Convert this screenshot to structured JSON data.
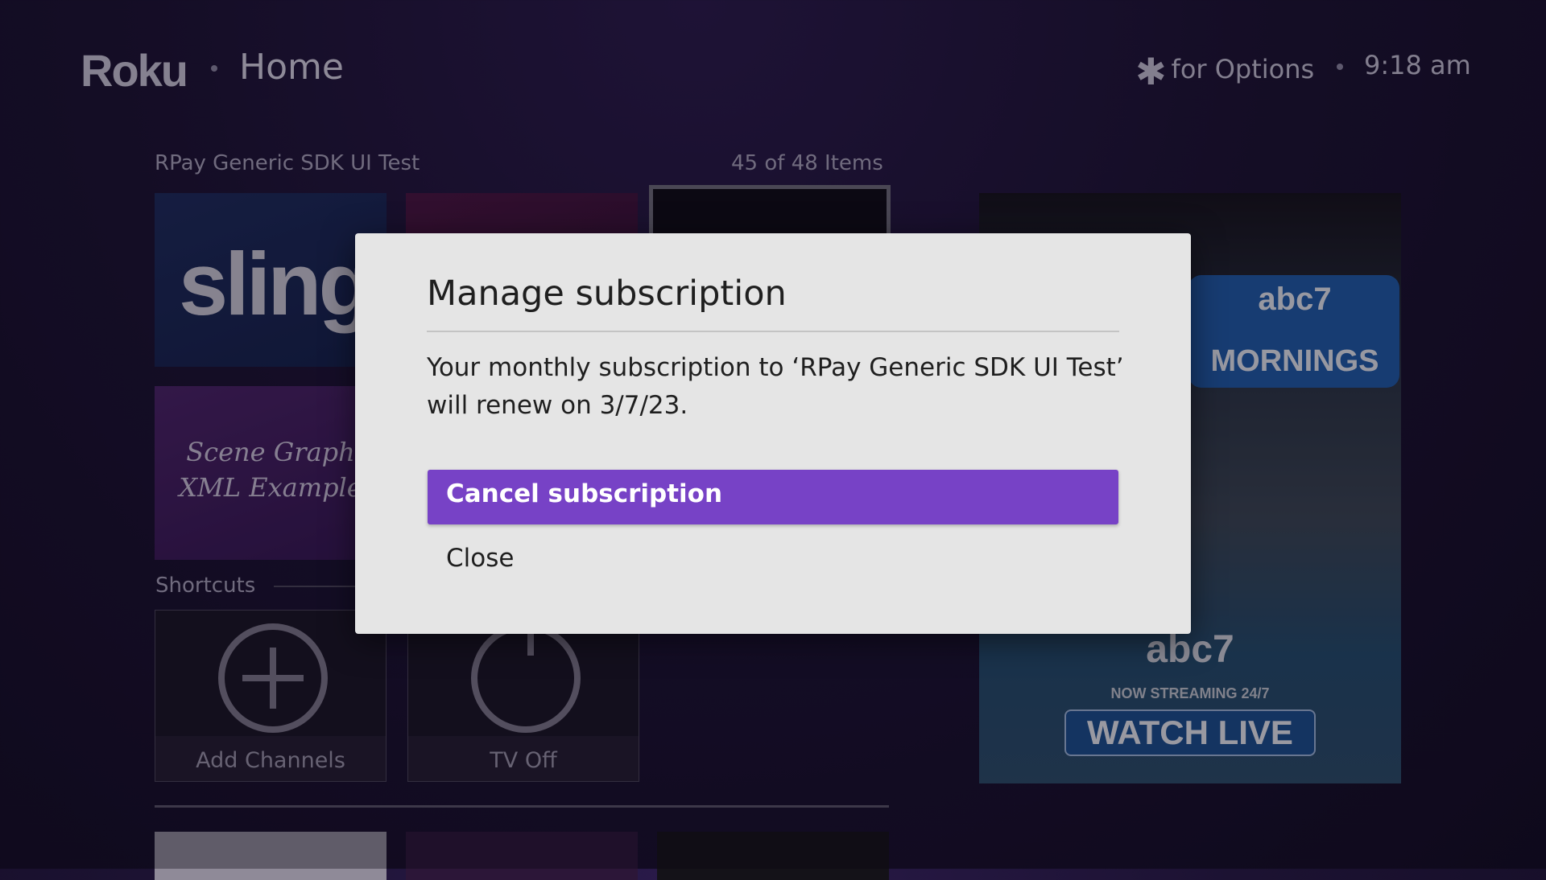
{
  "header": {
    "logo": "Roku",
    "title": "Home",
    "options_star": "✱",
    "options_text": "for Options",
    "time": "9:18 am"
  },
  "grid": {
    "title": "RPay Generic SDK UI Test",
    "count": "45 of 48 Items",
    "tiles": {
      "sling": "sling",
      "scene_graph_line1": "Scene Graph",
      "scene_graph_line2": "XML Example"
    }
  },
  "shortcuts": {
    "label": "Shortcuts",
    "items": [
      {
        "label": "Add Channels",
        "icon": "plus-circle-icon"
      },
      {
        "label": "TV Off",
        "icon": "power-icon"
      }
    ]
  },
  "ad": {
    "logo": "abc7",
    "mornings": "MORNINGS",
    "logo2": "abc7",
    "streaming": "NOW STREAMING 24/7",
    "watch": "WATCH LIVE"
  },
  "dialog": {
    "title": "Manage subscription",
    "body": "Your monthly subscription to ‘RPay Generic SDK UI Test’ will renew on 3/7/23.",
    "primary_button": "Cancel subscription",
    "secondary_button": "Close",
    "accent_color": "#7742c6"
  }
}
